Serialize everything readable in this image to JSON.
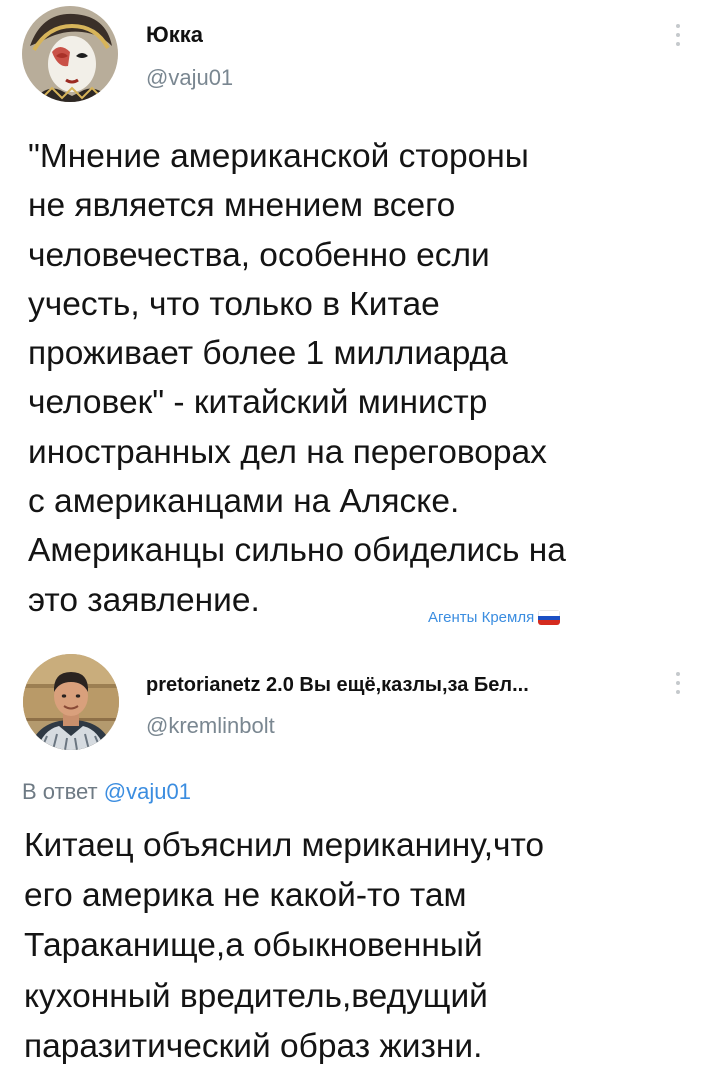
{
  "tweet1": {
    "display_name": "Юкка",
    "handle": "@vaju01",
    "text": "\"Мнение американской стороны\nне является мнением всего\nчеловечества, особенно если\nучесть, что только в Китае\nпроживает более 1 миллиарда\nчеловек\" - китайский министр\nиностранных дел на переговорах\nс американцами на Аляске.\nАмериканцы сильно обиделись на\nэто заявление.",
    "badge_label": "Агенты Кремля",
    "menu_icon": "more-vertical-icon"
  },
  "tweet2": {
    "display_name": "pretorianetz 2.0 Вы ещё,казлы,за Бел...",
    "handle": "@kremlinbolt",
    "reply_prefix": "В ответ",
    "reply_mention": "@vaju01",
    "text": "Китаец объяснил мериканину,что\nего америка не какой-то там\nТараканище,а обыкновенный\nкухонный вредитель,ведущий\nпаразитический образ жизни.",
    "menu_icon": "more-vertical-icon"
  },
  "colors": {
    "link": "#3b8de0",
    "muted": "#7a8791",
    "text": "#141414",
    "flag": [
      "#ffffff",
      "#1a4fc4",
      "#d52b1e"
    ]
  }
}
